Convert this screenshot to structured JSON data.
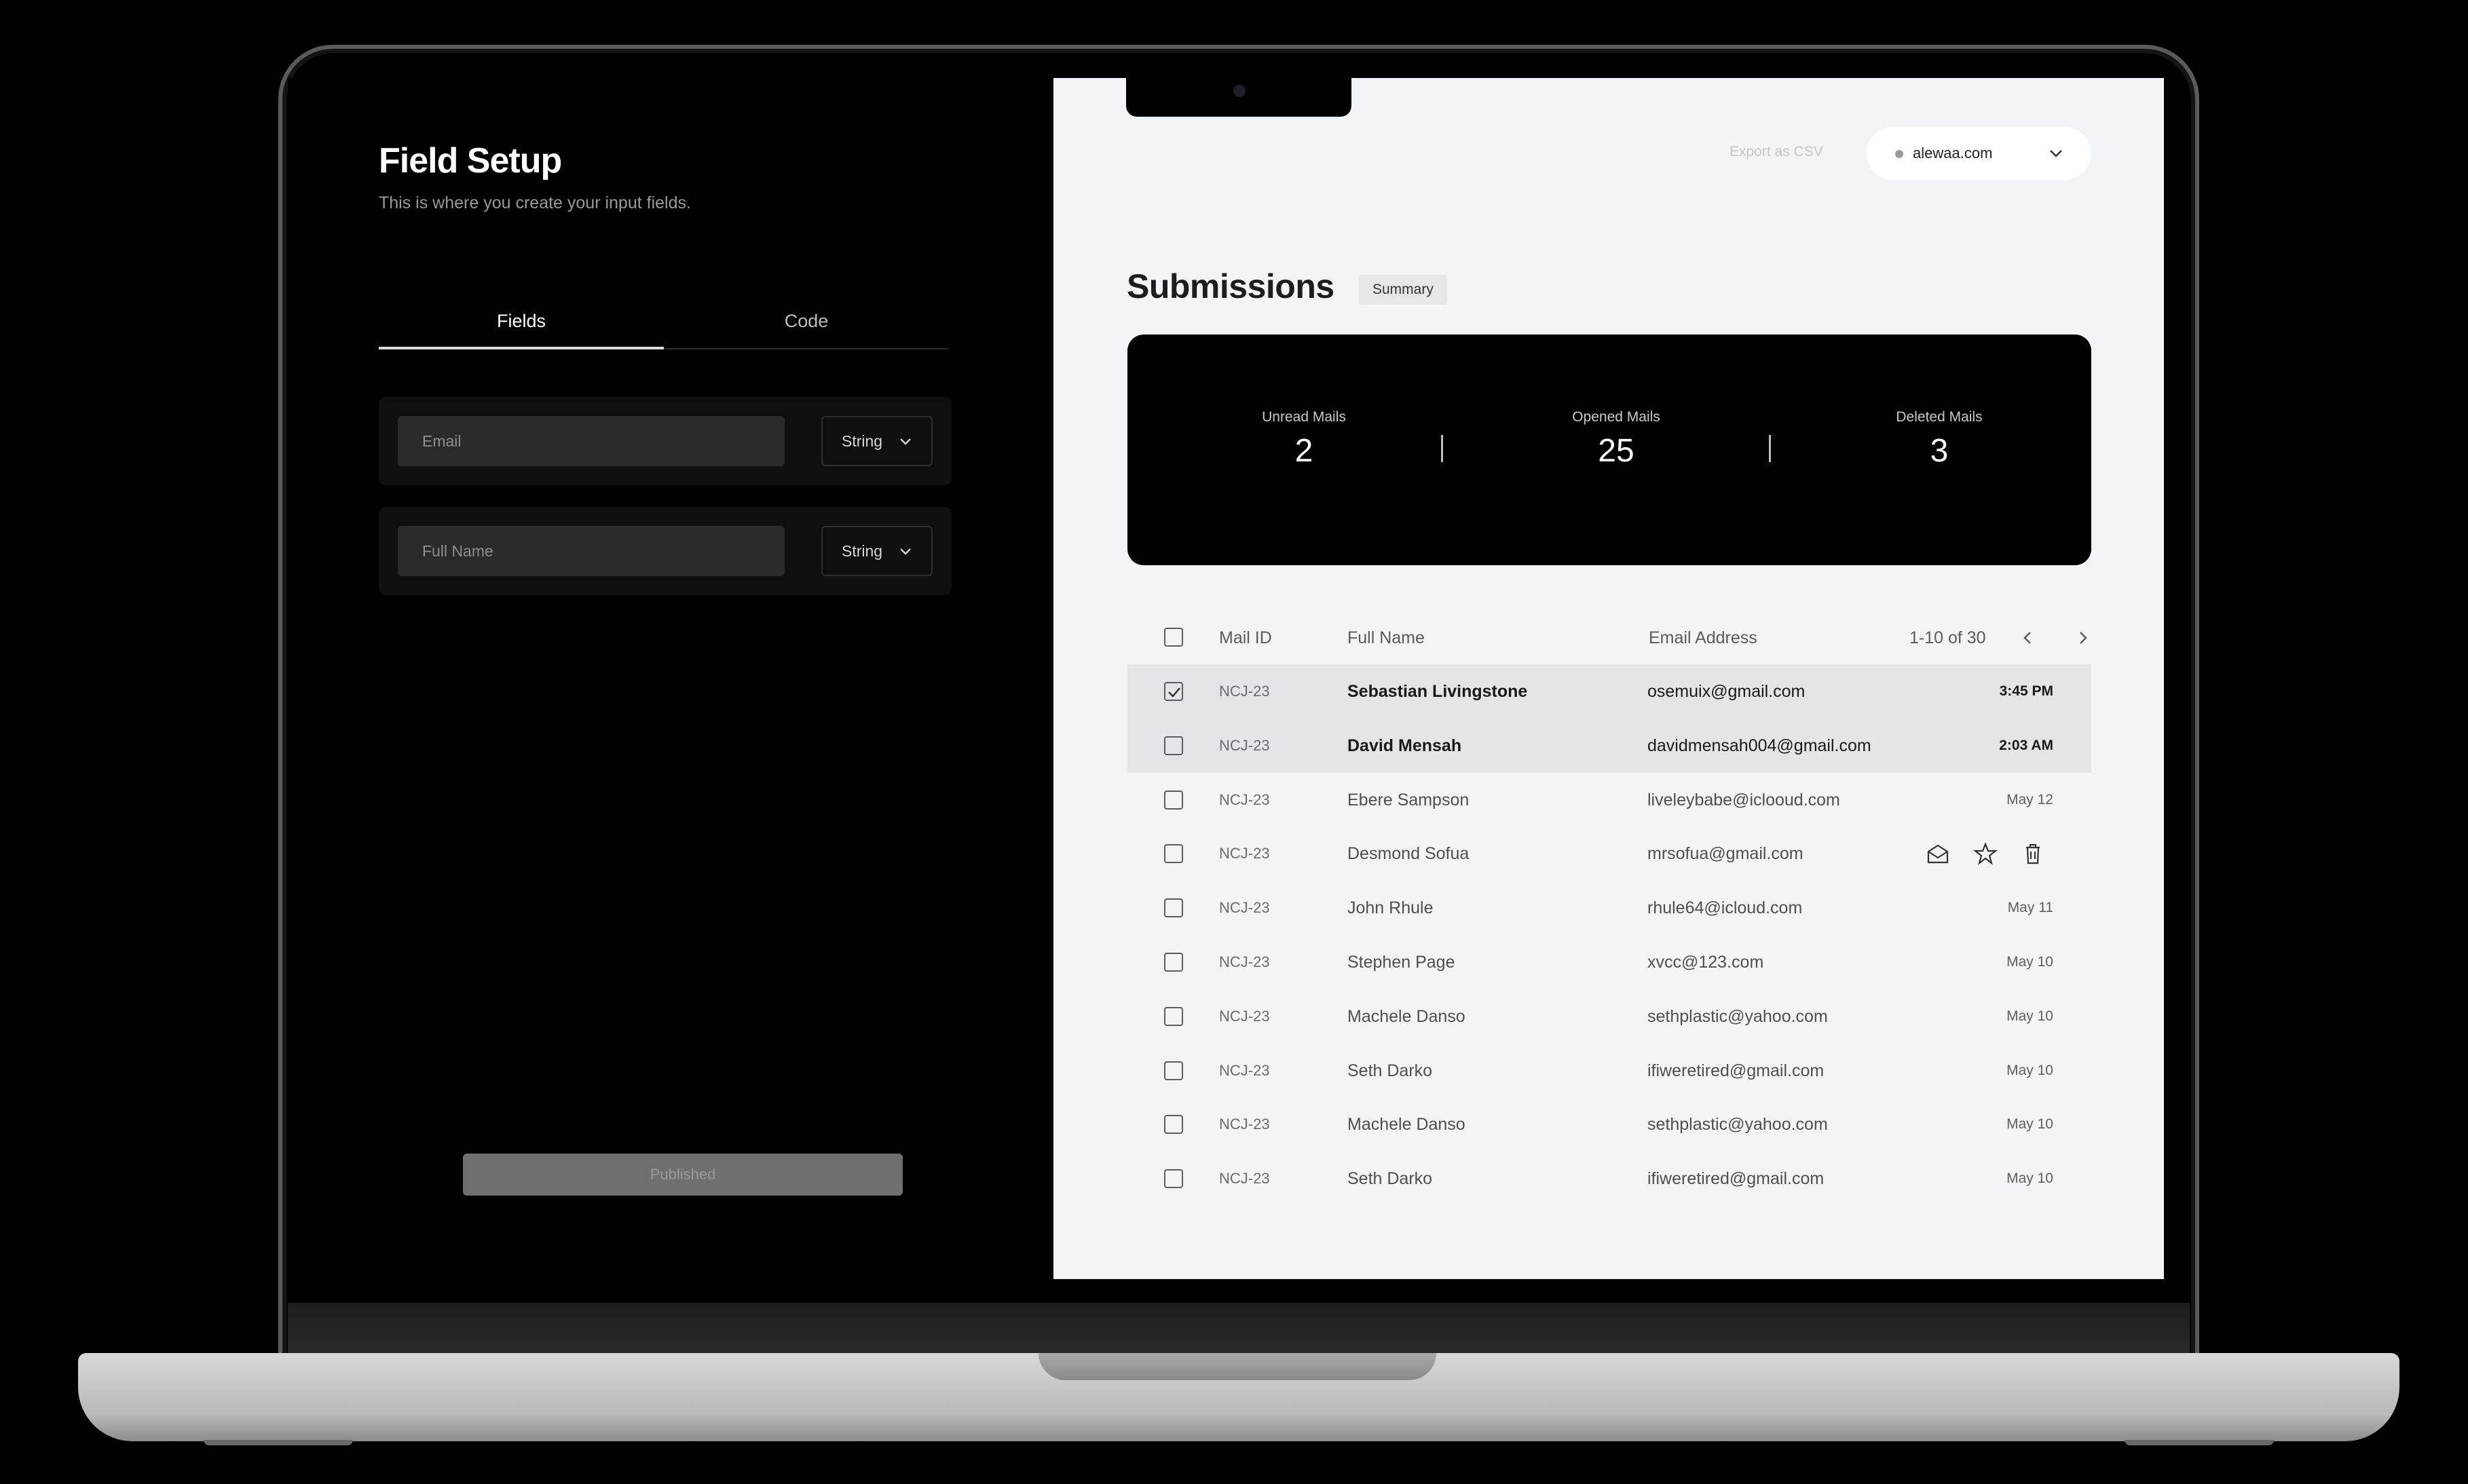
{
  "left_panel": {
    "title": "Field Setup",
    "subtitle": "This is where you create your input fields.",
    "tabs": [
      {
        "label": "Fields",
        "active": true
      },
      {
        "label": "Code",
        "active": false
      }
    ],
    "fields": [
      {
        "placeholder": "Email",
        "type": "String"
      },
      {
        "placeholder": "Full Name",
        "type": "String"
      }
    ],
    "publish_label": "Published"
  },
  "header": {
    "export_label": "Export as CSV",
    "domain": "alewaa.com"
  },
  "submissions": {
    "title": "Submissions",
    "badge": "Summary",
    "stats": [
      {
        "label": "Unread Mails",
        "value": "2"
      },
      {
        "label": "Opened Mails",
        "value": "25"
      },
      {
        "label": "Deleted Mails",
        "value": "3"
      }
    ]
  },
  "table": {
    "headers": {
      "mail_id": "Mail ID",
      "full_name": "Full Name",
      "email": "Email Address"
    },
    "pagination": "1-10 of 30",
    "rows": [
      {
        "id": "NCJ-23",
        "name": "Sebastian Livingstone",
        "email": "osemuix@gmail.com",
        "time": "3:45 PM",
        "checked": true,
        "unread": true
      },
      {
        "id": "NCJ-23",
        "name": "David Mensah",
        "email": "davidmensah004@gmail.com",
        "time": "2:03 AM",
        "checked": false,
        "unread": true
      },
      {
        "id": "NCJ-23",
        "name": "Ebere Sampson",
        "email": "liveleybabe@iclooud.com",
        "time": "May 12",
        "checked": false,
        "unread": false
      },
      {
        "id": "NCJ-23",
        "name": "Desmond Sofua",
        "email": "mrsofua@gmail.com",
        "time": "",
        "checked": false,
        "unread": false,
        "hover_actions": [
          "mail-open-icon",
          "star-icon",
          "trash-icon"
        ]
      },
      {
        "id": "NCJ-23",
        "name": "John Rhule",
        "email": "rhule64@icloud.com",
        "time": "May 11",
        "checked": false,
        "unread": false
      },
      {
        "id": "NCJ-23",
        "name": "Stephen Page",
        "email": "xvcc@123.com",
        "time": "May 10",
        "checked": false,
        "unread": false
      },
      {
        "id": "NCJ-23",
        "name": "Machele Danso",
        "email": "sethplastic@yahoo.com",
        "time": "May 10",
        "checked": false,
        "unread": false
      },
      {
        "id": "NCJ-23",
        "name": "Seth Darko",
        "email": "ifiweretired@gmail.com",
        "time": "May 10",
        "checked": false,
        "unread": false
      },
      {
        "id": "NCJ-23",
        "name": "Machele Danso",
        "email": "sethplastic@yahoo.com",
        "time": "May 10",
        "checked": false,
        "unread": false
      },
      {
        "id": "NCJ-23",
        "name": "Seth Darko",
        "email": "ifiweretired@gmail.com",
        "time": "May 10",
        "checked": false,
        "unread": false
      }
    ]
  },
  "colors": {
    "screen_right_bg": "#f3f4f6",
    "screen_left_bg": "#000000",
    "stats_card_bg": "#000000",
    "selected_row_bg": "#e4e5e9"
  }
}
